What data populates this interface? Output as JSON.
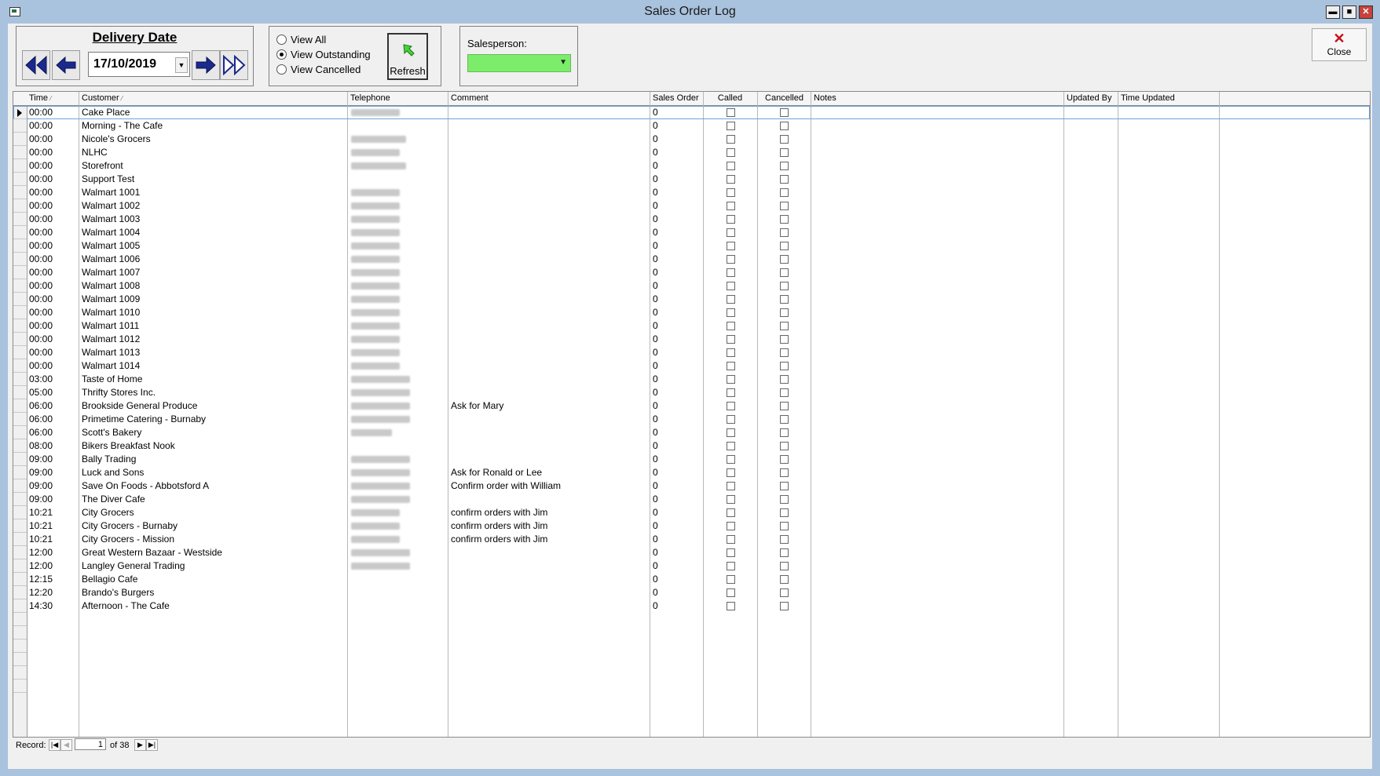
{
  "window": {
    "title": "Sales Order Log",
    "min_glyph": "▬",
    "max_glyph": "■",
    "close_glyph": "✕"
  },
  "delivery": {
    "label": "Delivery Date",
    "date": "17/10/2019"
  },
  "view_options": [
    {
      "label": "View All",
      "selected": false
    },
    {
      "label": "View Outstanding",
      "selected": true
    },
    {
      "label": "View Cancelled",
      "selected": false
    }
  ],
  "refresh_label": "Refresh",
  "salesperson": {
    "label": "Salesperson:",
    "value": "",
    "color": "#7ced6a"
  },
  "close_label": "Close",
  "columns": [
    "Time",
    "Customer",
    "Telephone",
    "Comment",
    "Sales Order",
    "Called",
    "Cancelled",
    "Notes",
    "Updated By",
    "Time Updated"
  ],
  "rows": [
    {
      "time": "00:00",
      "customer": "Cake Place",
      "comment": "",
      "sales_order": "0"
    },
    {
      "time": "00:00",
      "customer": "Morning - The Cafe",
      "comment": "",
      "sales_order": "0"
    },
    {
      "time": "00:00",
      "customer": "Nicole's Grocers",
      "comment": "",
      "sales_order": "0"
    },
    {
      "time": "00:00",
      "customer": "NLHC",
      "comment": "",
      "sales_order": "0"
    },
    {
      "time": "00:00",
      "customer": "Storefront",
      "comment": "",
      "sales_order": "0"
    },
    {
      "time": "00:00",
      "customer": "Support Test",
      "comment": "",
      "sales_order": "0"
    },
    {
      "time": "00:00",
      "customer": "Walmart 1001",
      "comment": "",
      "sales_order": "0"
    },
    {
      "time": "00:00",
      "customer": "Walmart 1002",
      "comment": "",
      "sales_order": "0"
    },
    {
      "time": "00:00",
      "customer": "Walmart 1003",
      "comment": "",
      "sales_order": "0"
    },
    {
      "time": "00:00",
      "customer": "Walmart 1004",
      "comment": "",
      "sales_order": "0"
    },
    {
      "time": "00:00",
      "customer": "Walmart 1005",
      "comment": "",
      "sales_order": "0"
    },
    {
      "time": "00:00",
      "customer": "Walmart 1006",
      "comment": "",
      "sales_order": "0"
    },
    {
      "time": "00:00",
      "customer": "Walmart 1007",
      "comment": "",
      "sales_order": "0"
    },
    {
      "time": "00:00",
      "customer": "Walmart 1008",
      "comment": "",
      "sales_order": "0"
    },
    {
      "time": "00:00",
      "customer": "Walmart 1009",
      "comment": "",
      "sales_order": "0"
    },
    {
      "time": "00:00",
      "customer": "Walmart 1010",
      "comment": "",
      "sales_order": "0"
    },
    {
      "time": "00:00",
      "customer": "Walmart 1011",
      "comment": "",
      "sales_order": "0"
    },
    {
      "time": "00:00",
      "customer": "Walmart 1012",
      "comment": "",
      "sales_order": "0"
    },
    {
      "time": "00:00",
      "customer": "Walmart 1013",
      "comment": "",
      "sales_order": "0"
    },
    {
      "time": "00:00",
      "customer": "Walmart 1014",
      "comment": "",
      "sales_order": "0"
    },
    {
      "time": "03:00",
      "customer": "Taste of Home",
      "comment": "",
      "sales_order": "0"
    },
    {
      "time": "05:00",
      "customer": "Thrifty Stores Inc.",
      "comment": "",
      "sales_order": "0"
    },
    {
      "time": "06:00",
      "customer": "Brookside General Produce",
      "comment": "Ask for Mary",
      "sales_order": "0"
    },
    {
      "time": "06:00",
      "customer": "Primetime Catering - Burnaby",
      "comment": "",
      "sales_order": "0"
    },
    {
      "time": "06:00",
      "customer": "Scott's Bakery",
      "comment": "",
      "sales_order": "0"
    },
    {
      "time": "08:00",
      "customer": "Bikers Breakfast Nook",
      "comment": "",
      "sales_order": "0"
    },
    {
      "time": "09:00",
      "customer": "Bally Trading",
      "comment": "",
      "sales_order": "0"
    },
    {
      "time": "09:00",
      "customer": "Luck and Sons",
      "comment": "Ask for Ronald or Lee",
      "sales_order": "0"
    },
    {
      "time": "09:00",
      "customer": "Save On Foods - Abbotsford A",
      "comment": "Confirm order with William",
      "sales_order": "0"
    },
    {
      "time": "09:00",
      "customer": "The Diver Cafe",
      "comment": "",
      "sales_order": "0"
    },
    {
      "time": "10:21",
      "customer": "City Grocers",
      "comment": "confirm orders with Jim",
      "sales_order": "0"
    },
    {
      "time": "10:21",
      "customer": "City Grocers - Burnaby",
      "comment": "confirm orders with Jim",
      "sales_order": "0"
    },
    {
      "time": "10:21",
      "customer": "City Grocers - Mission",
      "comment": "confirm orders with Jim",
      "sales_order": "0"
    },
    {
      "time": "12:00",
      "customer": "Great Western Bazaar - Westside",
      "comment": "",
      "sales_order": "0"
    },
    {
      "time": "12:00",
      "customer": "Langley General Trading",
      "comment": "",
      "sales_order": "0"
    },
    {
      "time": "12:15",
      "customer": "Bellagio Cafe",
      "comment": "",
      "sales_order": "0"
    },
    {
      "time": "12:20",
      "customer": "Brando's Burgers",
      "comment": "",
      "sales_order": "0"
    },
    {
      "time": "14:30",
      "customer": "Afternoon - The Cafe",
      "comment": "",
      "sales_order": "0"
    }
  ],
  "record_nav": {
    "label": "Record:",
    "current": "1",
    "of_text": "of 38"
  }
}
